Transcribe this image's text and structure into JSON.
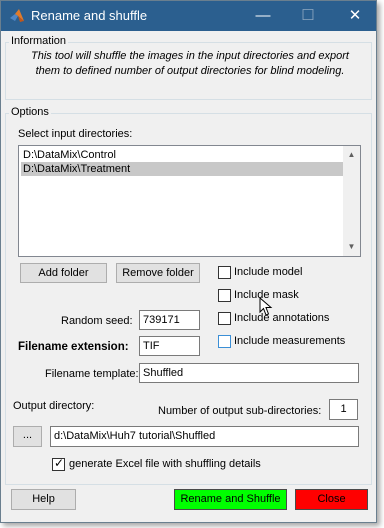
{
  "window": {
    "title": "Rename and shuffle",
    "controls": {
      "minimize": "—",
      "maximize": "☐",
      "close": "✕"
    }
  },
  "information": {
    "legend": "Information",
    "text": "This tool will shuffle the images in the input directories and export them to defined number of output directories for blind modeling."
  },
  "options": {
    "legend": "Options",
    "input_dirs_label": "Select input directories:",
    "input_dirs": [
      "D:\\DataMix\\Control",
      "D:\\DataMix\\Treatment"
    ],
    "selected_dir_index": 1,
    "add_folder_label": "Add folder",
    "remove_folder_label": "Remove folder",
    "include_model_label": "Include model",
    "include_mask_label": "Include mask",
    "include_annotations_label": "Include annotations",
    "include_measurements_label": "Include measurements",
    "random_seed_label": "Random seed:",
    "random_seed_value": "739171",
    "filename_ext_label": "Filename extension:",
    "filename_ext_value": "TIF",
    "filename_template_label": "Filename template:",
    "filename_template_value": "Shuffled",
    "output_dir_label": "Output directory:",
    "num_subdirs_label": "Number of output sub-directories:",
    "num_subdirs_value": "1",
    "browse_label": "...",
    "output_dir_value": "d:\\DataMix\\Huh7 tutorial\\Shuffled",
    "excel_label": "generate Excel file with shuffling details",
    "excel_checked": true
  },
  "footer": {
    "help_label": "Help",
    "rename_shuffle_label": "Rename and Shuffle",
    "close_label": "Close"
  },
  "colors": {
    "titlebar": "#2b5f8f",
    "rename_button": "#00ff00",
    "close_button": "#ff0000"
  }
}
